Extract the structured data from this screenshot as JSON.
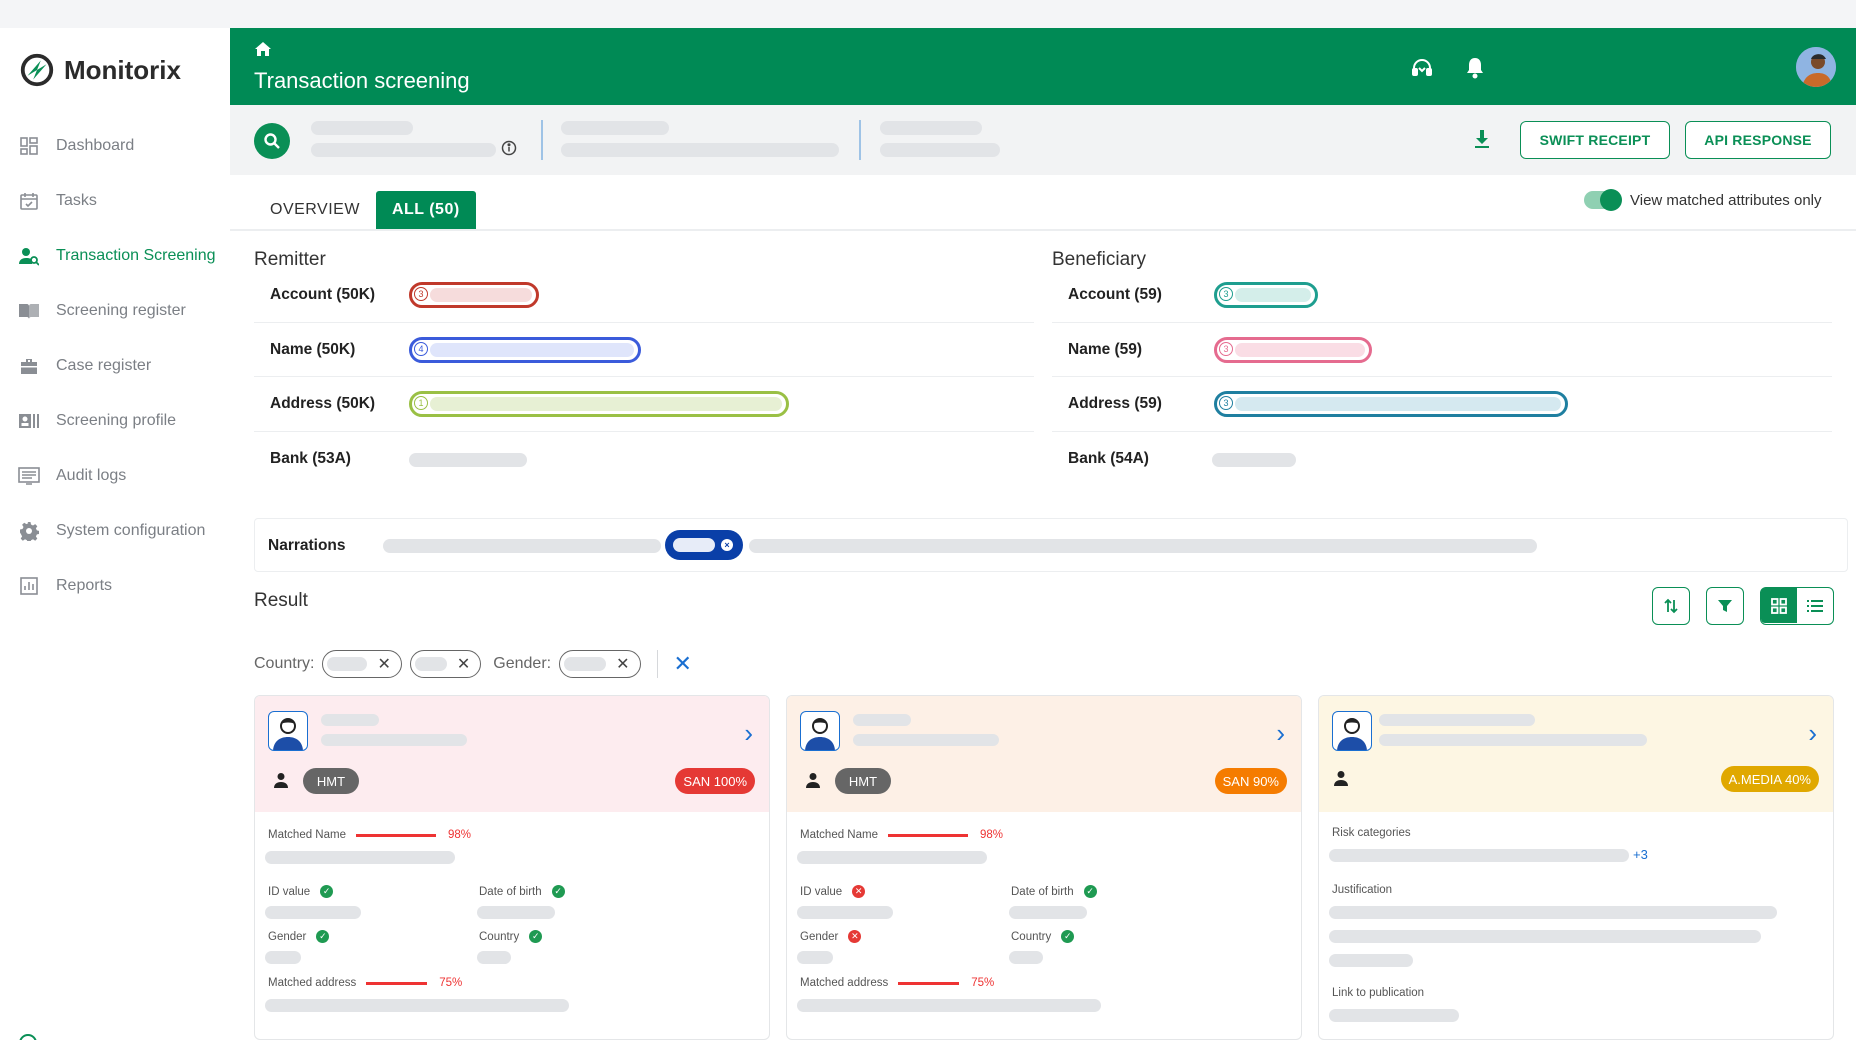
{
  "brand": {
    "name": "Monitorix",
    "accent": "#0a8f56"
  },
  "sidebar": {
    "items": [
      {
        "label": "Dashboard",
        "icon": "dashboard-icon"
      },
      {
        "label": "Tasks",
        "icon": "calendar-check-icon"
      },
      {
        "label": "Transaction Screening",
        "icon": "user-search-icon",
        "active": true
      },
      {
        "label": "Screening register",
        "icon": "book-icon"
      },
      {
        "label": "Case register",
        "icon": "briefcase-icon"
      },
      {
        "label": "Screening profile",
        "icon": "profile-card-icon"
      },
      {
        "label": "Audit logs",
        "icon": "log-list-icon"
      },
      {
        "label": "System configuration",
        "icon": "gear-icon"
      },
      {
        "label": "Reports",
        "icon": "bar-chart-icon"
      }
    ]
  },
  "header": {
    "title": "Transaction screening"
  },
  "toolbar": {
    "swift_receipt": "SWIFT RECEIPT",
    "api_response": "API RESPONSE"
  },
  "tabs": {
    "overview": "OVERVIEW",
    "all": "ALL (50)"
  },
  "toggle": {
    "label": "View matched attributes only",
    "on": true
  },
  "remitter": {
    "title": "Remitter",
    "rows": [
      {
        "label": "Account (50K)",
        "count": "3",
        "color": "#c0392b"
      },
      {
        "label": "Name (50K)",
        "count": "4",
        "color": "#3b5bdb"
      },
      {
        "label": "Address (50K)",
        "count": "1",
        "color": "#9ac045"
      },
      {
        "label": "Bank (53A)"
      }
    ]
  },
  "beneficiary": {
    "title": "Beneficiary",
    "rows": [
      {
        "label": "Account (59)",
        "count": "3",
        "color": "#1e9e8f"
      },
      {
        "label": "Name (59)",
        "count": "3",
        "color": "#e56b8f"
      },
      {
        "label": "Address (59)",
        "count": "3",
        "color": "#1f7fa0"
      },
      {
        "label": "Bank (54A)"
      }
    ]
  },
  "narrations": {
    "label": "Narrations"
  },
  "result": {
    "title": "Result",
    "filters": {
      "country_label": "Country:",
      "gender_label": "Gender:"
    }
  },
  "cards": [
    {
      "tag": "HMT",
      "badge": "SAN 100%",
      "badge_color": "#e53935",
      "bg": "#fdecef",
      "matched_name_label": "Matched Name",
      "matched_name_pct": "98%",
      "matched_name_value": 98,
      "id_label": "ID value",
      "dob_label": "Date of birth",
      "gender_label": "Gender",
      "country_label": "Country",
      "address_label": "Matched address",
      "address_pct": "75%",
      "address_value": 75
    },
    {
      "tag": "HMT",
      "badge": "SAN 90%",
      "badge_color": "#f57c00",
      "bg": "#fdf0e6",
      "matched_name_label": "Matched Name",
      "matched_name_pct": "98%",
      "matched_name_value": 98,
      "id_label": "ID value",
      "dob_label": "Date of birth",
      "gender_label": "Gender",
      "country_label": "Country",
      "address_label": "Matched address",
      "address_pct": "75%",
      "address_value": 75
    },
    {
      "badge": "A.MEDIA 40%",
      "badge_color": "#e0a800",
      "bg": "#fdf6e3",
      "risk_label": "Risk categories",
      "risk_more": "+3",
      "justification_label": "Justification",
      "link_label": "Link to publication"
    }
  ]
}
